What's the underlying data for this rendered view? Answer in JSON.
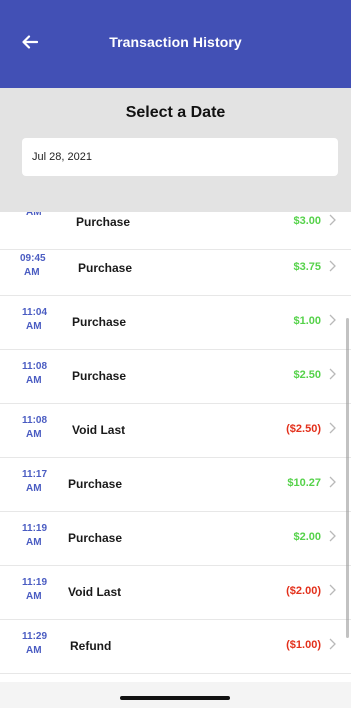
{
  "header": {
    "title": "Transaction History",
    "back_icon": "arrow-left-icon",
    "color": "#4250b5"
  },
  "date_section": {
    "heading": "Select a Date",
    "date_value": "Jul 28, 2021"
  },
  "transactions": [
    {
      "time_hm": "",
      "time_ampm": "AM",
      "type": "Purchase",
      "amount": "$3.00",
      "sign": "pos"
    },
    {
      "time_hm": "09:45",
      "time_ampm": "AM",
      "type": "Purchase",
      "amount": "$3.75",
      "sign": "pos"
    },
    {
      "time_hm": "11:04",
      "time_ampm": "AM",
      "type": "Purchase",
      "amount": "$1.00",
      "sign": "pos"
    },
    {
      "time_hm": "11:08",
      "time_ampm": "AM",
      "type": "Purchase",
      "amount": "$2.50",
      "sign": "pos"
    },
    {
      "time_hm": "11:08",
      "time_ampm": "AM",
      "type": "Void Last",
      "amount": "($2.50)",
      "sign": "neg"
    },
    {
      "time_hm": "11:17",
      "time_ampm": "AM",
      "type": "Purchase",
      "amount": "$10.27",
      "sign": "pos"
    },
    {
      "time_hm": "11:19",
      "time_ampm": "AM",
      "type": "Purchase",
      "amount": "$2.00",
      "sign": "pos"
    },
    {
      "time_hm": "11:19",
      "time_ampm": "AM",
      "type": "Void Last",
      "amount": "($2.00)",
      "sign": "neg"
    },
    {
      "time_hm": "11:29",
      "time_ampm": "AM",
      "type": "Refund",
      "amount": "($1.00)",
      "sign": "neg"
    }
  ],
  "colors": {
    "time": "#4a5cc2",
    "positive_amount": "#55d24a",
    "negative_amount": "#e3301b",
    "date_panel": "#e3e3e3"
  }
}
